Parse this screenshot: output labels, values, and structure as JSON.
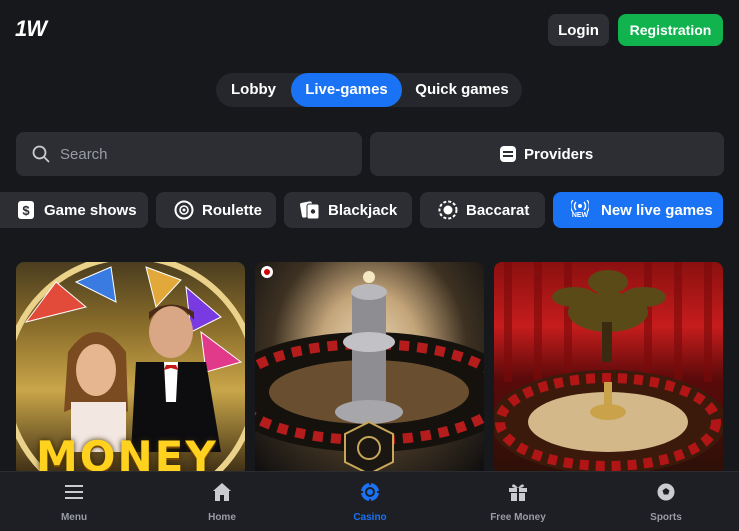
{
  "header": {
    "logo": "1W",
    "login_label": "Login",
    "registration_label": "Registration"
  },
  "tabs": [
    {
      "label": "Lobby",
      "active": false
    },
    {
      "label": "Live-games",
      "active": true
    },
    {
      "label": "Quick games",
      "active": false
    }
  ],
  "search": {
    "placeholder": "Search",
    "value": ""
  },
  "providers_label": "Providers",
  "categories": [
    {
      "label": "Game shows",
      "icon": "dollar-card-icon"
    },
    {
      "label": "Roulette",
      "icon": "roulette-icon"
    },
    {
      "label": "Blackjack",
      "icon": "cards-icon"
    },
    {
      "label": "Baccarat",
      "icon": "baccarat-chip-icon"
    },
    {
      "label": "New live games",
      "icon": "broadcast-new-icon",
      "badge": "NEW"
    }
  ],
  "cards": [
    {
      "thumb_text": "MONEY",
      "theme": "money-wheel-show"
    },
    {
      "flag": "japan",
      "theme": "roulette-wheel-closeup"
    },
    {
      "theme": "roulette-red-curtain"
    }
  ],
  "colors": {
    "background": "#17181c",
    "accent": "#1a72f5",
    "registration": "#11b34f",
    "surface": "#2c2e33"
  },
  "bottom_nav": [
    {
      "label": "Menu",
      "icon": "hamburger-icon",
      "active": false
    },
    {
      "label": "Home",
      "icon": "home-icon",
      "active": false
    },
    {
      "label": "Casino",
      "icon": "casino-chip-icon",
      "active": true
    },
    {
      "label": "Free Money",
      "icon": "gift-icon",
      "active": false
    },
    {
      "label": "Sports",
      "icon": "soccer-ball-icon",
      "active": false
    }
  ]
}
